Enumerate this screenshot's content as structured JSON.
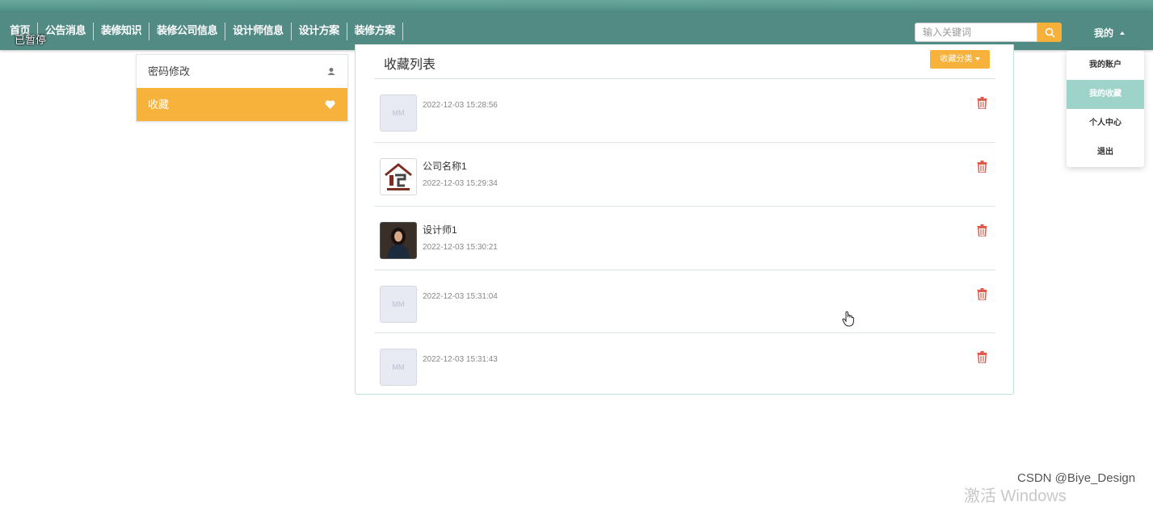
{
  "nav": {
    "items": [
      "首页",
      "公告消息",
      "装修知识",
      "装修公司信息",
      "设计师信息",
      "设计方案",
      "装修方案"
    ],
    "overlay_text": "已暂停"
  },
  "search": {
    "placeholder": "输入关键词"
  },
  "user_menu": {
    "label": "我的",
    "items": [
      "我的账户",
      "我的收藏",
      "个人中心",
      "退出"
    ],
    "active_index": 1
  },
  "sidebar": {
    "items": [
      {
        "label": "密码修改",
        "icon": "user-icon"
      },
      {
        "label": "收藏",
        "icon": "heart-icon",
        "active": true
      }
    ]
  },
  "favorites": {
    "title": "收藏列表",
    "category_button": "收藏分类",
    "placeholder_thumb": "MM",
    "rows": [
      {
        "name": "",
        "time": "2022-12-03 15:28:56",
        "thumb": "placeholder"
      },
      {
        "name": "公司名称1",
        "time": "2022-12-03 15:29:34",
        "thumb": "company-logo"
      },
      {
        "name": "设计师1",
        "time": "2022-12-03 15:30:21",
        "thumb": "designer-photo"
      },
      {
        "name": "",
        "time": "2022-12-03 15:31:04",
        "thumb": "placeholder"
      },
      {
        "name": "",
        "time": "2022-12-03 15:31:43",
        "thumb": "placeholder"
      }
    ]
  },
  "colors": {
    "navbar": "#528a84",
    "accent": "#f7b23c",
    "active_menu": "#9ed3c9",
    "delete": "#e05a4a"
  },
  "watermarks": {
    "csdn": "CSDN @Biye_Design",
    "windows": "激活 Windows"
  }
}
